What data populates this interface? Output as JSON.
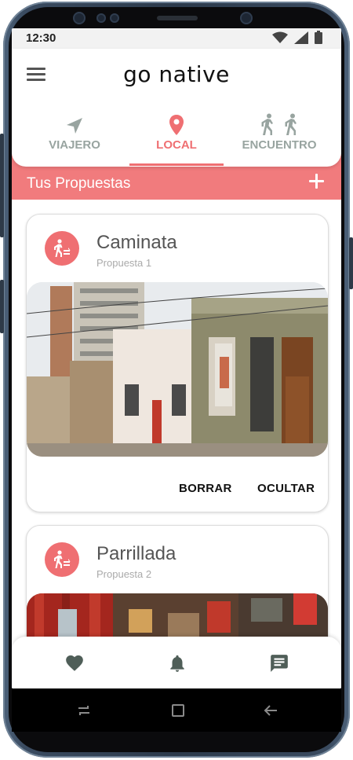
{
  "status_bar": {
    "time": "12:30"
  },
  "app": {
    "title": "go native"
  },
  "tabs": [
    {
      "label": "VIAJERO",
      "icon": "navigation-arrow-icon"
    },
    {
      "label": "LOCAL",
      "icon": "location-pin-icon",
      "active": true
    },
    {
      "label": "ENCUENTRO",
      "icon": "walking-people-icon"
    }
  ],
  "section": {
    "title": "Tus Propuestas",
    "add_icon": "plus-icon"
  },
  "cards": [
    {
      "title": "Caminata",
      "subtitle": "Propuesta 1",
      "icon": "walking-person-icon",
      "image": "street-photo"
    },
    {
      "title": "Parrillada",
      "subtitle": "Propuesta 2",
      "icon": "walking-person-icon",
      "image": "restaurant-photo"
    }
  ],
  "card_actions": {
    "delete_label": "BORRAR",
    "hide_label": "OCULTAR"
  },
  "bottom_nav": [
    "heart-icon",
    "bell-icon",
    "chat-icon"
  ],
  "colors": {
    "accent": "#ef6f72",
    "section_bar": "#f17b7d",
    "inactive": "#98a4a0",
    "nav_icon": "#4f5e58"
  }
}
